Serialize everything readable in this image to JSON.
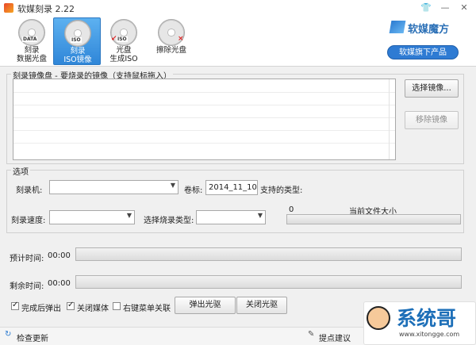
{
  "window": {
    "title": "软媒刻录 2.22"
  },
  "toolbar": {
    "items": [
      {
        "tag": "DATA",
        "line1": "刻录",
        "line2": "数据光盘"
      },
      {
        "tag": "ISO",
        "line1": "刻录",
        "line2": "ISO镜像"
      },
      {
        "tag": "ISO",
        "line1": "光盘",
        "line2": "生成ISO"
      },
      {
        "tag": "",
        "mark": "×",
        "line1": "擦除光盘",
        "line2": ""
      }
    ],
    "brand": "软媒魔方",
    "products_button": "软媒旗下产品"
  },
  "image_group": {
    "title": "刻录镜像盘 - 要烧录的镜像（支持鼠标拖入）",
    "choose_button": "选择镜像...",
    "remove_button": "移除镜像"
  },
  "options": {
    "title": "选项",
    "burner_label": "刻录机:",
    "volume_label": "卷标:",
    "volume_value": "2014_11_10",
    "supported_label": "支持的类型:",
    "speed_label": "刻录速度:",
    "burn_type_label": "选择烧录类型:",
    "size_value": "0",
    "size_label": "当前文件大小"
  },
  "progress": {
    "estimate_label": "预计时间:",
    "estimate_value": "00:00",
    "remain_label": "剩余时间:",
    "remain_value": "00:00"
  },
  "bottom": {
    "eject_after": "完成后弹出",
    "close_media": "关闭媒体",
    "context_menu": "右键菜单关联",
    "eject_button": "弹出光驱",
    "close_button": "关闭光驱"
  },
  "status": {
    "check_update": "检查更新",
    "feedback": "提点建议"
  },
  "watermark": {
    "text": "系统哥",
    "url": "www.xitongge.com"
  }
}
